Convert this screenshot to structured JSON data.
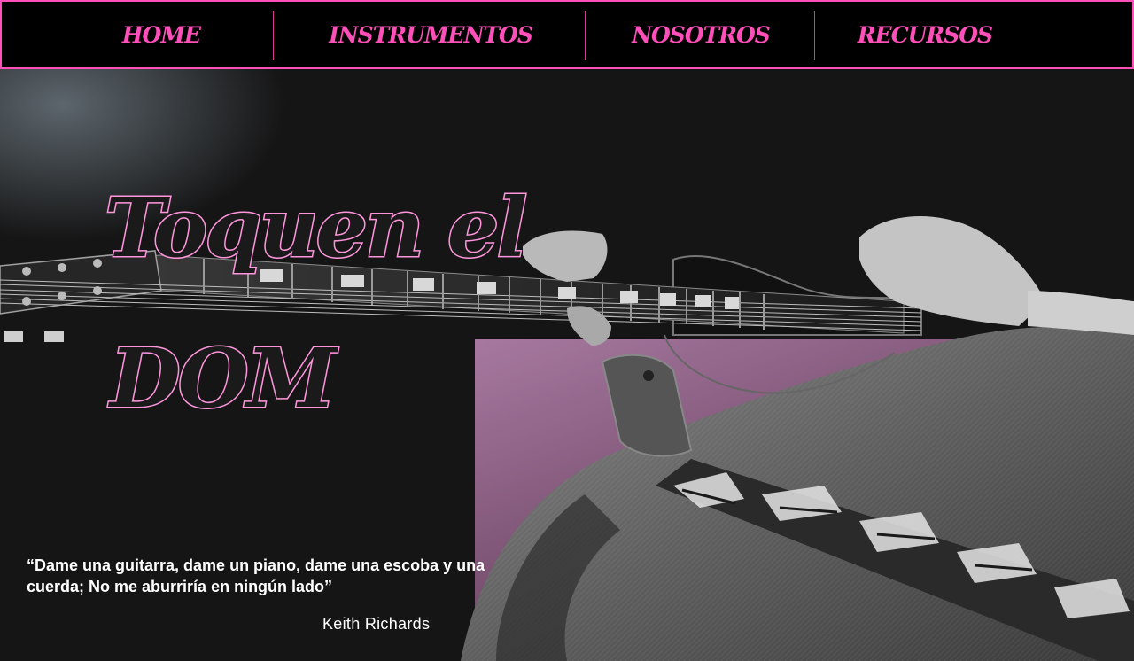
{
  "nav": {
    "items": [
      {
        "label": "HOME"
      },
      {
        "label": "INSTRUMENTOS"
      },
      {
        "label": "NOSOTROS"
      },
      {
        "label": "RECURSOS"
      }
    ],
    "colors": {
      "accent": "#ff4fb8",
      "background": "#000000"
    }
  },
  "hero": {
    "title_line1": "Toquen el",
    "title_line2": "DOM",
    "image": "guitar-player-photo",
    "quote": {
      "text": "“Dame una guitarra, dame un piano, dame una escoba y una cuerda; No me aburriría en ningún lado”",
      "author": "Keith Richards"
    },
    "colors": {
      "title_outline": "#ff96dc",
      "overlay": "#c87ab8"
    }
  }
}
